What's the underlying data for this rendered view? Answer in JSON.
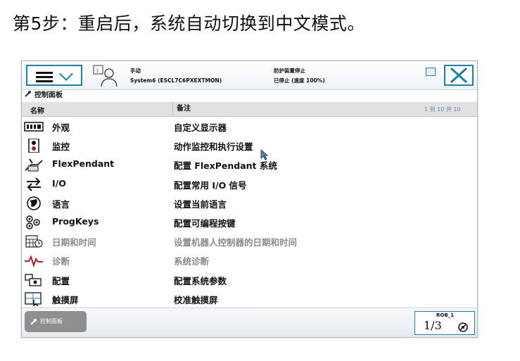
{
  "slide_title": "第5步：重启后，系统自动切换到中文模式。",
  "header": {
    "mode_label": "手动",
    "system_name": "System6 (ESCL7C6PXEXTMON)",
    "state_label": "防护装置停止",
    "state_detail": "已停止 (速度 100%)"
  },
  "breadcrumb": "控制面板",
  "table": {
    "col_name": "名称",
    "col_note": "备注",
    "count": "1 到 10 共 10",
    "rows": [
      {
        "icon": "display-icon",
        "name": "外观",
        "desc": "自定义显示器",
        "dim": false
      },
      {
        "icon": "monitor-icon",
        "name": "监控",
        "desc": "动作监控和执行设置",
        "dim": false
      },
      {
        "icon": "flexpendant-icon",
        "name": "FlexPendant",
        "desc": "配置 FlexPendant 系统",
        "dim": false
      },
      {
        "icon": "io-arrows-icon",
        "name": "I/O",
        "desc": "配置常用 I/O 信号",
        "dim": false
      },
      {
        "icon": "globe-icon",
        "name": "语言",
        "desc": "设置当前语言",
        "dim": false
      },
      {
        "icon": "progkeys-icon",
        "name": "ProgKeys",
        "desc": "配置可编程按键",
        "dim": false
      },
      {
        "icon": "calendar-icon",
        "name": "日期和时间",
        "desc": "设置机器人控制器的日期和时间",
        "dim": true
      },
      {
        "icon": "waveform-icon",
        "name": "诊断",
        "desc": "系统诊断",
        "dim": true
      },
      {
        "icon": "config-icon",
        "name": "配置",
        "desc": "配置系统参数",
        "dim": false
      },
      {
        "icon": "touchscreen-icon",
        "name": "触摸屏",
        "desc": "校准触摸屏",
        "dim": false
      }
    ]
  },
  "footer": {
    "task_label": "控制面板",
    "rob_label": "ROB_1",
    "fraction": "1/3"
  },
  "colors": {
    "accent": "#1d80a6",
    "header_bg": "#e1e1e1",
    "dim_text": "#8a8a8a"
  }
}
